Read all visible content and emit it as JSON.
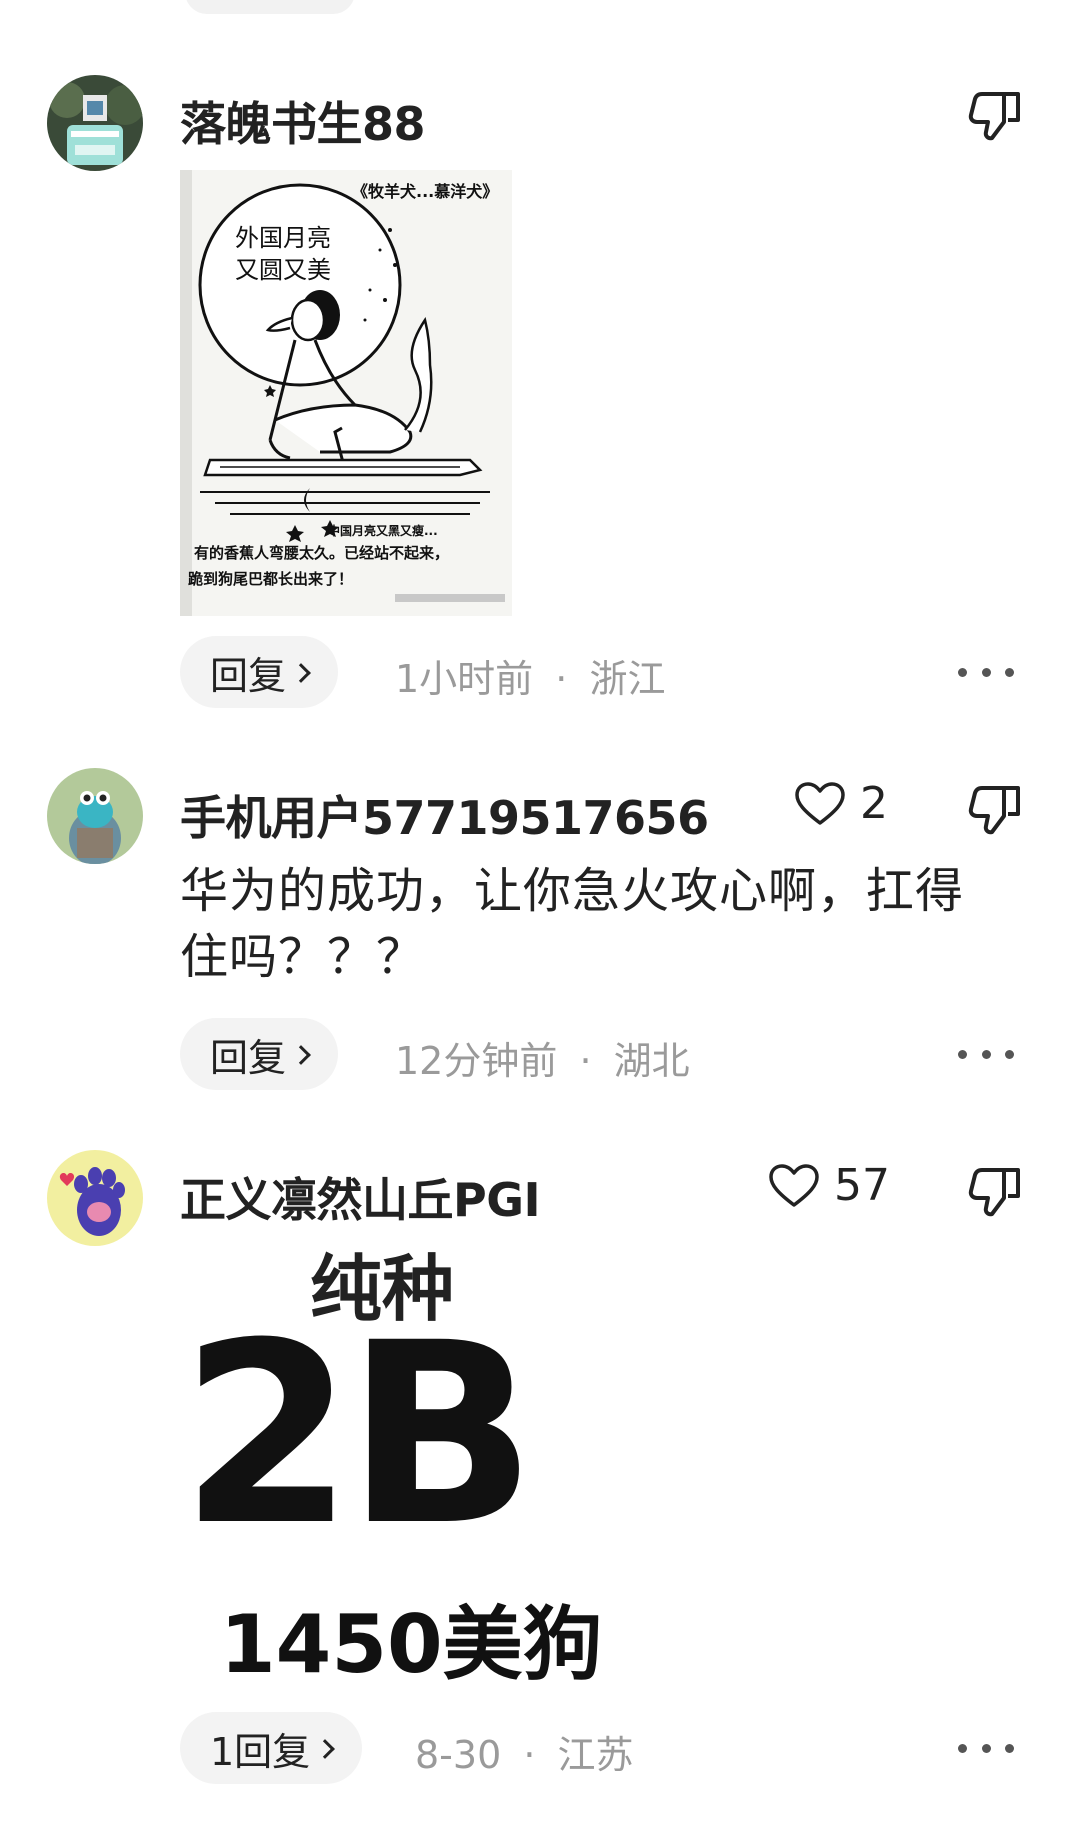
{
  "comments": [
    {
      "username": "落魄书生88",
      "like_count": null,
      "reply_label": "回复",
      "time": "1小时前",
      "location": "浙江",
      "image": {
        "title": "《牧羊犬...慕洋犬》",
        "moon_text_1": "外国月亮",
        "moon_text_2": "又圆又美",
        "small_text": "中国月亮又黑又瘦...",
        "caption_1": "有的香蕉人弯腰太久。已经站不起来，",
        "caption_2": "跪到狗尾巴都长出来了！"
      }
    },
    {
      "username": "手机用户57719517656",
      "like_count": "2",
      "text": "华为的成功，让你急火攻心啊，扛得住吗？？？",
      "reply_label": "回复",
      "time": "12分钟前",
      "location": "湖北"
    },
    {
      "username": "正义凛然山丘PGI",
      "like_count": "57",
      "reply_label": "1回复",
      "time": "8-30",
      "location": "江苏",
      "meme": {
        "line1": "纯种",
        "line2": "2B",
        "line3": "1450美狗"
      }
    }
  ],
  "separator": "·",
  "icons": {
    "like": "heart-outline-icon",
    "dislike": "thumbs-down-icon",
    "more": "more-dots-icon",
    "reply_chevron": "chevron-right-icon"
  }
}
